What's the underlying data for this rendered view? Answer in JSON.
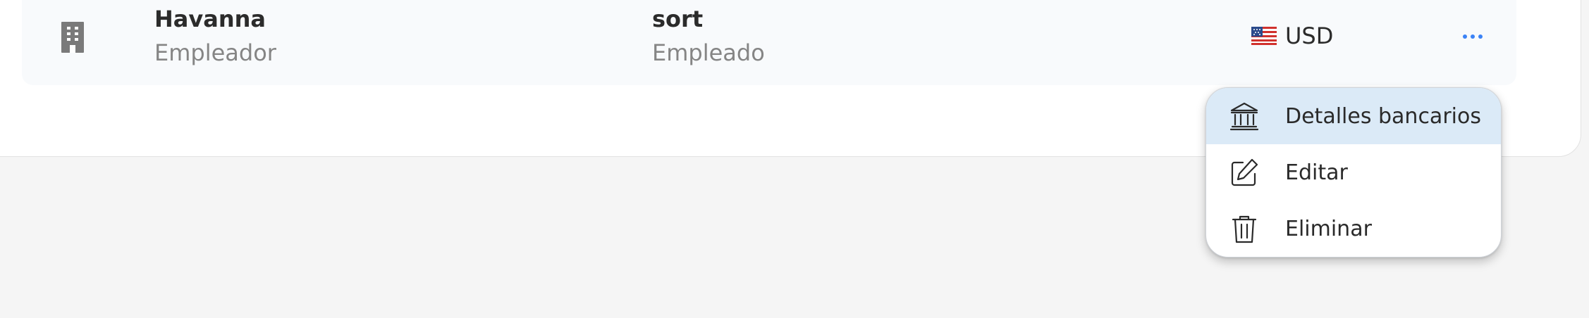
{
  "table": {
    "row": {
      "icon": "building-icon",
      "employer": {
        "name": "Havanna",
        "role": "Empleador"
      },
      "employee": {
        "name": "sort",
        "role": "Empleado"
      },
      "currency": {
        "flag": "us-flag-icon",
        "code": "USD"
      },
      "more_icon": "more-horizontal-icon"
    }
  },
  "menu": {
    "items": [
      {
        "label": "Detalles bancarios",
        "icon": "bank-icon",
        "active": true
      },
      {
        "label": "Editar",
        "icon": "edit-icon",
        "active": false
      },
      {
        "label": "Eliminar",
        "icon": "trash-icon",
        "active": false
      }
    ]
  },
  "colors": {
    "accent": "#3b82f6",
    "menu_highlight": "#dbeaf7",
    "row_background": "#f8fafc",
    "page_background": "#f5f5f5"
  }
}
